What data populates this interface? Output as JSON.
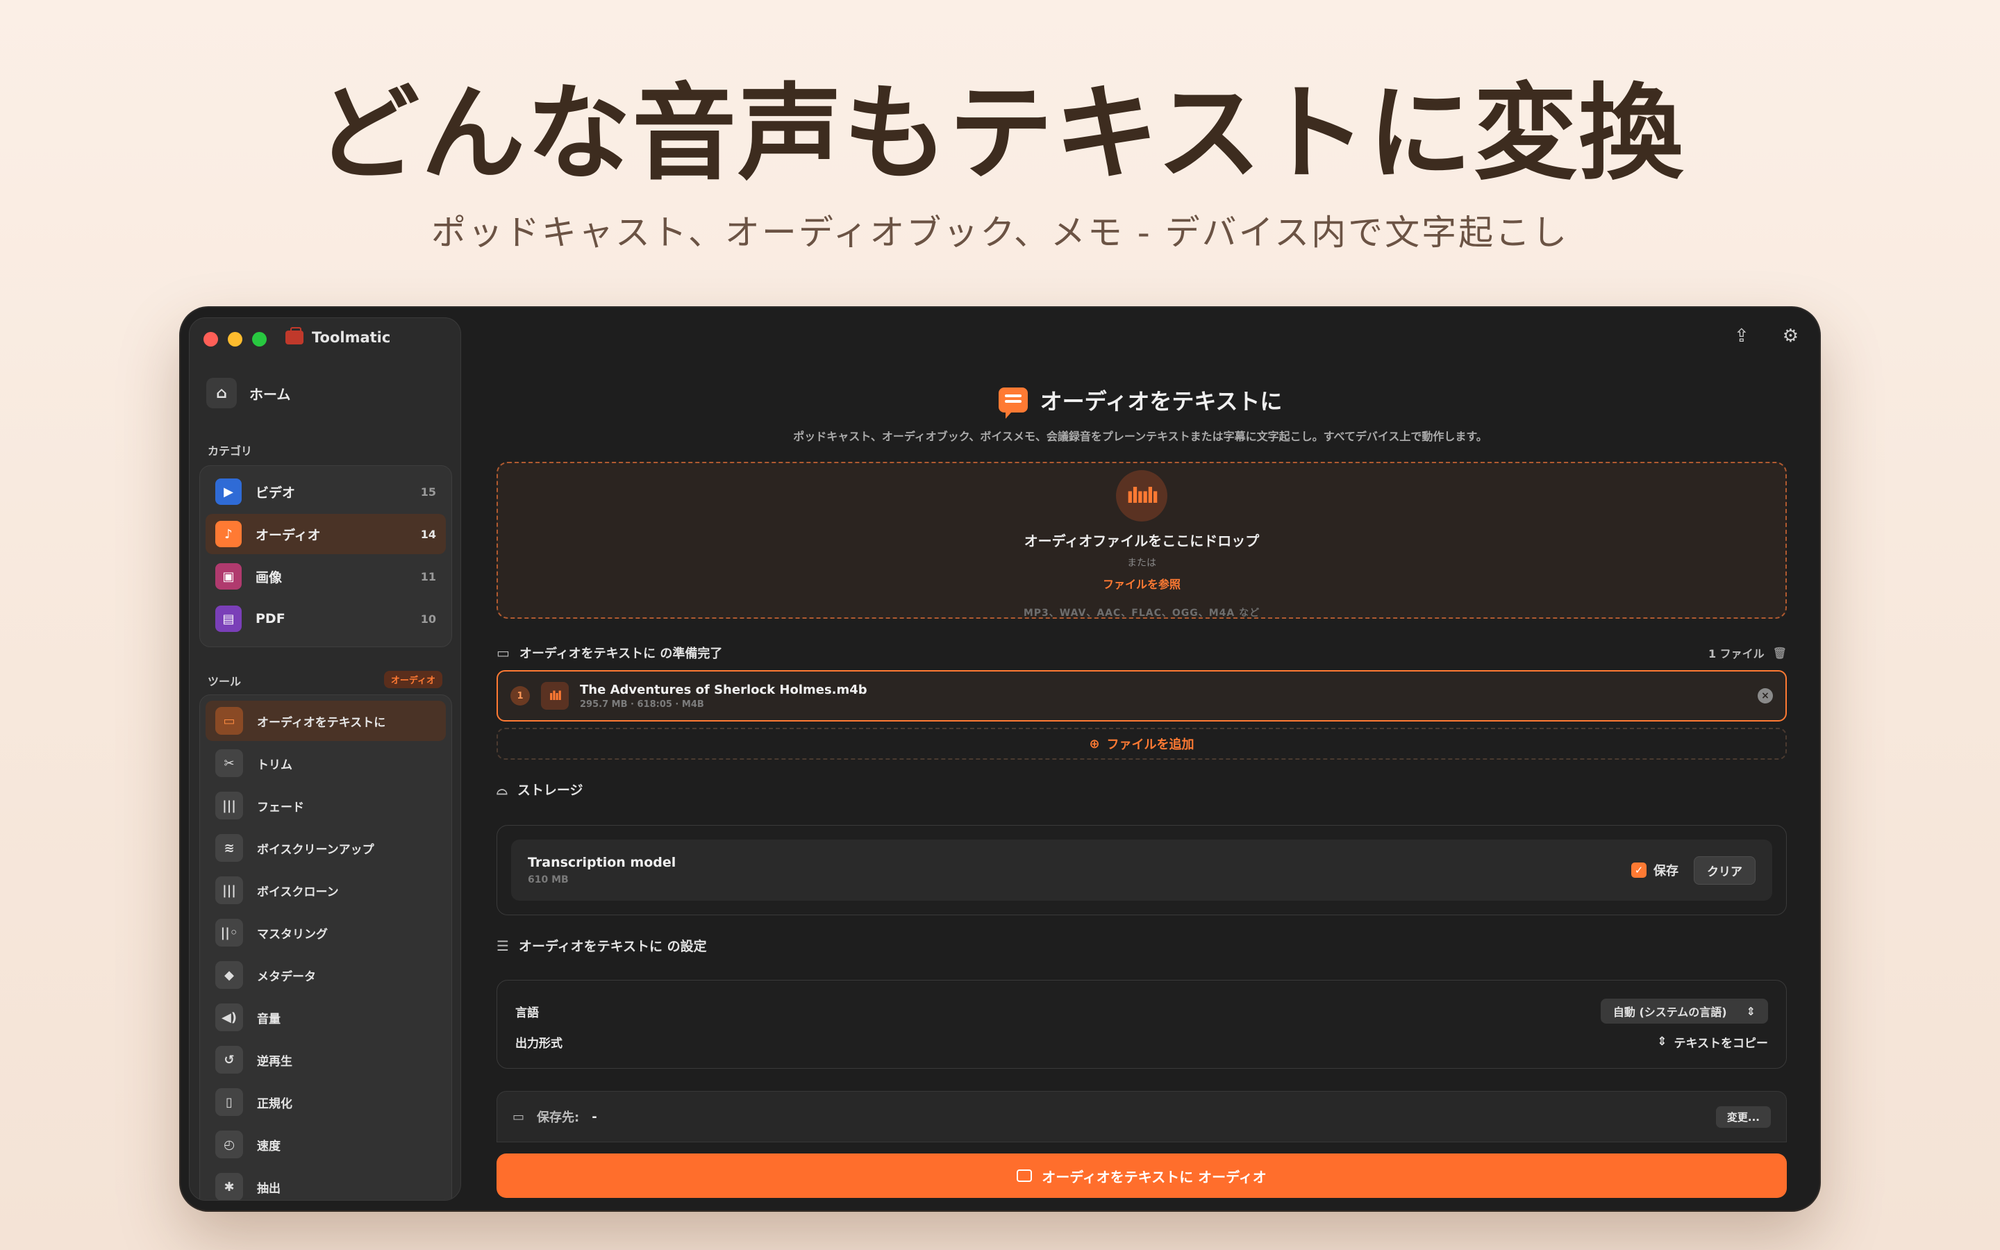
{
  "hero": {
    "title": "どんな音声もテキストに変換",
    "subtitle": "ポッドキャスト、オーディオブック、メモ - デバイス内で文字起こし"
  },
  "window": {
    "app_name": "Toolmatic",
    "traffic_colors": [
      "#ff5f57",
      "#febc2e",
      "#28c840"
    ]
  },
  "sidebar": {
    "home_label": "ホーム",
    "categories_label": "カテゴリ",
    "categories": [
      {
        "label": "ビデオ",
        "count": "15",
        "color": "#2f6bd6",
        "icon": "video-icon"
      },
      {
        "label": "オーディオ",
        "count": "14",
        "color": "#ff7a33",
        "icon": "music-note-icon"
      },
      {
        "label": "画像",
        "count": "11",
        "color": "#b03a6e",
        "icon": "image-icon"
      },
      {
        "label": "PDF",
        "count": "10",
        "color": "#7a3fb8",
        "icon": "pdf-icon"
      }
    ],
    "tools_label": "ツール",
    "tools_badge": "オーディオ",
    "tools": [
      {
        "label": "オーディオをテキストに",
        "icon": "chat-icon"
      },
      {
        "label": "トリム",
        "icon": "scissors-icon"
      },
      {
        "label": "フェード",
        "icon": "waveform-icon"
      },
      {
        "label": "ボイスクリーンアップ",
        "icon": "noise-clean-icon"
      },
      {
        "label": "ボイスクローン",
        "icon": "voice-clone-icon"
      },
      {
        "label": "マスタリング",
        "icon": "mastering-icon"
      },
      {
        "label": "メタデータ",
        "icon": "tag-icon"
      },
      {
        "label": "音量",
        "icon": "speaker-icon"
      },
      {
        "label": "逆再生",
        "icon": "reverse-icon"
      },
      {
        "label": "正規化",
        "icon": "normalize-icon"
      },
      {
        "label": "速度",
        "icon": "speed-icon"
      },
      {
        "label": "抽出",
        "icon": "extract-icon"
      }
    ]
  },
  "main": {
    "title": "オーディオをテキストに",
    "description": "ポッドキャスト、オーディオブック、ボイスメモ、会議録音をプレーンテキストまたは字幕に文字起こし。すべてデバイス上で動作します。",
    "dropzone": {
      "main": "オーディオファイルをここにドロップ",
      "or": "または",
      "browse": "ファイルを参照",
      "formats": "MP3、WAV、AAC、FLAC、OGG、M4A など"
    },
    "ready": {
      "label": "オーディオをテキストに の準備完了",
      "count": "1 ファイル"
    },
    "file": {
      "index": "1",
      "name": "The Adventures of Sherlock Holmes.m4b",
      "meta": "295.7 MB · 618:05 · M4B"
    },
    "add_file": "ファイルを追加",
    "storage": {
      "label": "ストレージ",
      "model_title": "Transcription model",
      "model_size": "610 MB",
      "save_label": "保存",
      "clear_label": "クリア"
    },
    "settings": {
      "label": "オーディオをテキストに の設定",
      "language_label": "言語",
      "language_value": "自動 (システムの言語)",
      "output_label": "出力形式",
      "output_value": "テキストをコピー"
    },
    "destination": {
      "label": "保存先:",
      "value": "-",
      "change": "変更..."
    },
    "cta": "オーディオをテキストに オーディオ"
  },
  "accent": "#ff7a33"
}
